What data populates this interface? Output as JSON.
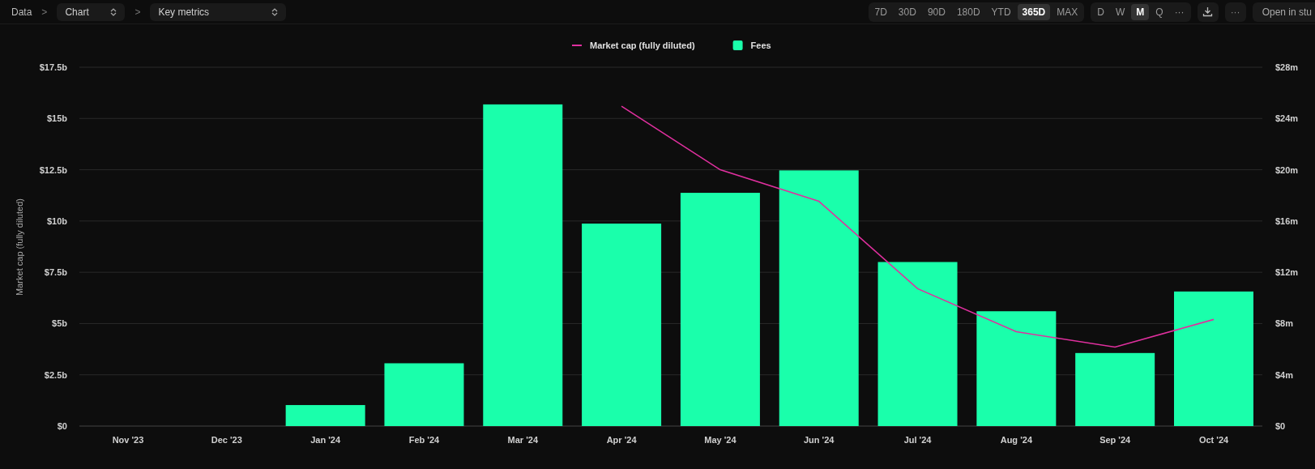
{
  "breadcrumb": {
    "root": "Data",
    "separator": ">",
    "selects": [
      {
        "label": "Chart"
      },
      {
        "label": "Key metrics"
      }
    ]
  },
  "ranges": [
    {
      "label": "7D",
      "selected": false
    },
    {
      "label": "30D",
      "selected": false
    },
    {
      "label": "90D",
      "selected": false
    },
    {
      "label": "180D",
      "selected": false
    },
    {
      "label": "YTD",
      "selected": false
    },
    {
      "label": "365D",
      "selected": true
    },
    {
      "label": "MAX",
      "selected": false
    }
  ],
  "granularity": [
    {
      "label": "D",
      "selected": false
    },
    {
      "label": "W",
      "selected": false
    },
    {
      "label": "M",
      "selected": true
    },
    {
      "label": "Q",
      "selected": false
    },
    {
      "label": "···",
      "selected": false
    }
  ],
  "more_button": "···",
  "open_button": "Open in stu",
  "chart_data": {
    "type": "bar",
    "grid": true,
    "legend": "top",
    "ylabel": "Market cap (fully diluted)",
    "categories": [
      "Nov '23",
      "Dec '23",
      "Jan '24",
      "Feb '24",
      "Mar '24",
      "Apr '24",
      "May '24",
      "Jun '24",
      "Jul '24",
      "Aug '24",
      "Sep '24",
      "Oct '24"
    ],
    "series": [
      {
        "name": "Market cap (fully diluted)",
        "type": "line",
        "color": "#e0309f",
        "values": [
          null,
          null,
          null,
          null,
          null,
          15.6,
          12.5,
          10.96,
          6.7,
          4.6,
          3.85,
          5.2
        ]
      },
      {
        "name": "Fees",
        "axis": "y2",
        "color": "#1affab",
        "values": [
          0,
          0,
          1.64,
          4.9,
          25.1,
          15.8,
          18.2,
          19.95,
          12.8,
          8.96,
          5.7,
          10.5
        ]
      }
    ],
    "ylim": [
      0,
      17.5
    ],
    "yticks": [
      {
        "value": 0,
        "label": "$0"
      },
      {
        "value": 2.5,
        "label": "$2.5b"
      },
      {
        "value": 5,
        "label": "$5b"
      },
      {
        "value": 7.5,
        "label": "$7.5b"
      },
      {
        "value": 10,
        "label": "$10b"
      },
      {
        "value": 12.5,
        "label": "$12.5b"
      },
      {
        "value": 15,
        "label": "$15b"
      },
      {
        "value": 17.5,
        "label": "$17.5b"
      }
    ],
    "y2lim": [
      0,
      28
    ],
    "y2ticks": [
      {
        "value": 0,
        "label": "$0"
      },
      {
        "value": 4,
        "label": "$4m"
      },
      {
        "value": 8,
        "label": "$8m"
      },
      {
        "value": 12,
        "label": "$12m"
      },
      {
        "value": 16,
        "label": "$16m"
      },
      {
        "value": 20,
        "label": "$20m"
      },
      {
        "value": 24,
        "label": "$24m"
      },
      {
        "value": 28,
        "label": "$28m"
      }
    ]
  }
}
